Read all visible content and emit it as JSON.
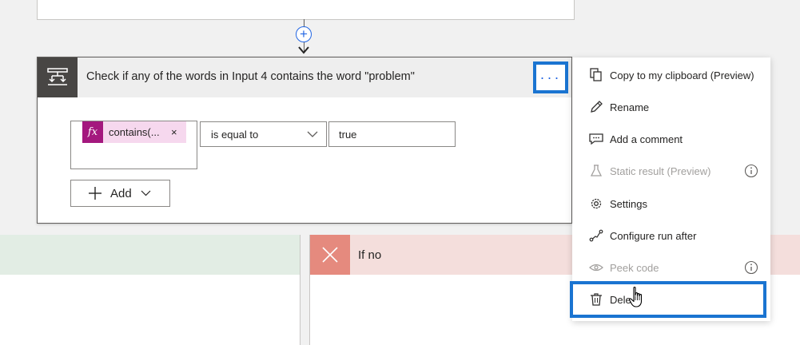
{
  "condition": {
    "title": "Check if any of the words in Input 4 contains the word \"problem\"",
    "more_label": "···",
    "expression": {
      "fx_label": "fx",
      "token_text": "contains(...",
      "remove_label": "×"
    },
    "operator": "is equal to",
    "value": "true",
    "add_label": "Add"
  },
  "branches": {
    "no_label": "If no"
  },
  "context_menu": {
    "items": [
      {
        "label": "Copy to my clipboard (Preview)",
        "icon": "copy-icon",
        "disabled": false
      },
      {
        "label": "Rename",
        "icon": "pencil-icon",
        "disabled": false
      },
      {
        "label": "Add a comment",
        "icon": "comment-icon",
        "disabled": false
      },
      {
        "label": "Static result (Preview)",
        "icon": "flask-icon",
        "disabled": true
      },
      {
        "label": "Settings",
        "icon": "gear-icon",
        "disabled": false
      },
      {
        "label": "Configure run after",
        "icon": "run-after-icon",
        "disabled": false
      },
      {
        "label": "Peek code",
        "icon": "eye-icon",
        "disabled": true
      },
      {
        "label": "Dele",
        "icon": "trash-icon",
        "disabled": false
      }
    ]
  },
  "colors": {
    "accent_blue": "#1a74d1",
    "fx_magenta": "#a4187e",
    "token_pink": "#f6d8ee",
    "yes_branch_green": "#e2ede4",
    "no_branch_red": "#f4dedc",
    "no_icon_salmon": "#e58a7e",
    "condition_icon_bg": "#484644"
  }
}
